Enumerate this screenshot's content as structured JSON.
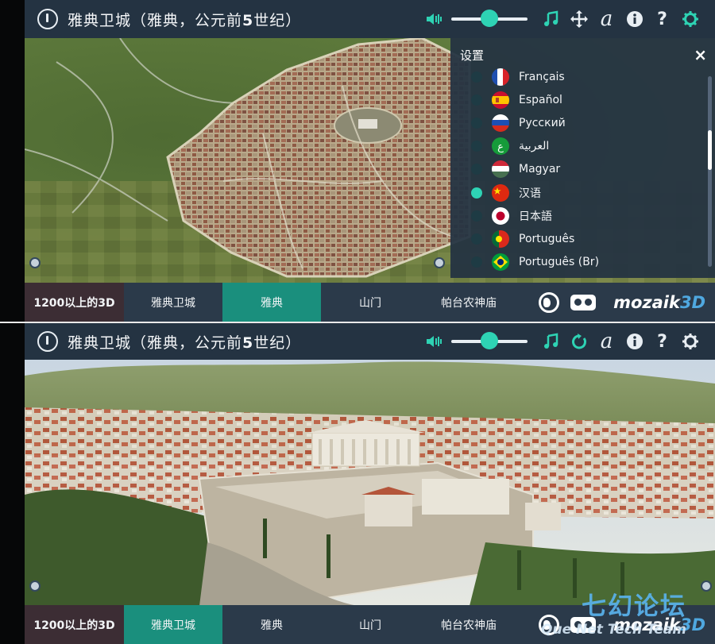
{
  "title_prefix": "雅典卫城（雅典，公元前",
  "title_bold": "5",
  "title_suffix": "世纪）",
  "top": {
    "volume_level_percent": 50,
    "settings": {
      "title": "设置",
      "close_label": "×",
      "languages": [
        {
          "label": "Français",
          "selected": false,
          "flag": "fr"
        },
        {
          "label": "Español",
          "selected": false,
          "flag": "es"
        },
        {
          "label": "Русский",
          "selected": false,
          "flag": "ru"
        },
        {
          "label": "العربية",
          "selected": false,
          "flag": "ar"
        },
        {
          "label": "Magyar",
          "selected": false,
          "flag": "hu"
        },
        {
          "label": "汉语",
          "selected": true,
          "flag": "cn"
        },
        {
          "label": "日本語",
          "selected": false,
          "flag": "jp"
        },
        {
          "label": "Português",
          "selected": false,
          "flag": "pt"
        },
        {
          "label": "Português (Br)",
          "selected": false,
          "flag": "br"
        }
      ]
    },
    "toolbar_icons": [
      "volume-icon",
      "music-icon",
      "move-icon",
      "font-icon",
      "info-icon",
      "help-icon",
      "settings-icon"
    ]
  },
  "bottom": {
    "volume_level_percent": 50,
    "toolbar_icons": [
      "volume-icon",
      "music-icon",
      "rotate-icon",
      "font-icon",
      "info-icon",
      "help-icon",
      "settings-icon"
    ]
  },
  "nav": {
    "tabs": [
      "1200以上的3D",
      "雅典卫城",
      "雅典",
      "山门",
      "帕台农神庙"
    ],
    "top_active_index": 2,
    "bottom_active_index": 1,
    "brand": "mozaik",
    "brand_accent": "3D"
  },
  "watermark": {
    "line1": "七幻论坛",
    "line2": "Que Net Tech Team"
  },
  "colors": {
    "accent": "#2ed3b4",
    "titlebar": "#243342",
    "navbar": "#2b3a4a",
    "active_tab": "#1a8f7d",
    "first_tab": "#3c2d34"
  }
}
